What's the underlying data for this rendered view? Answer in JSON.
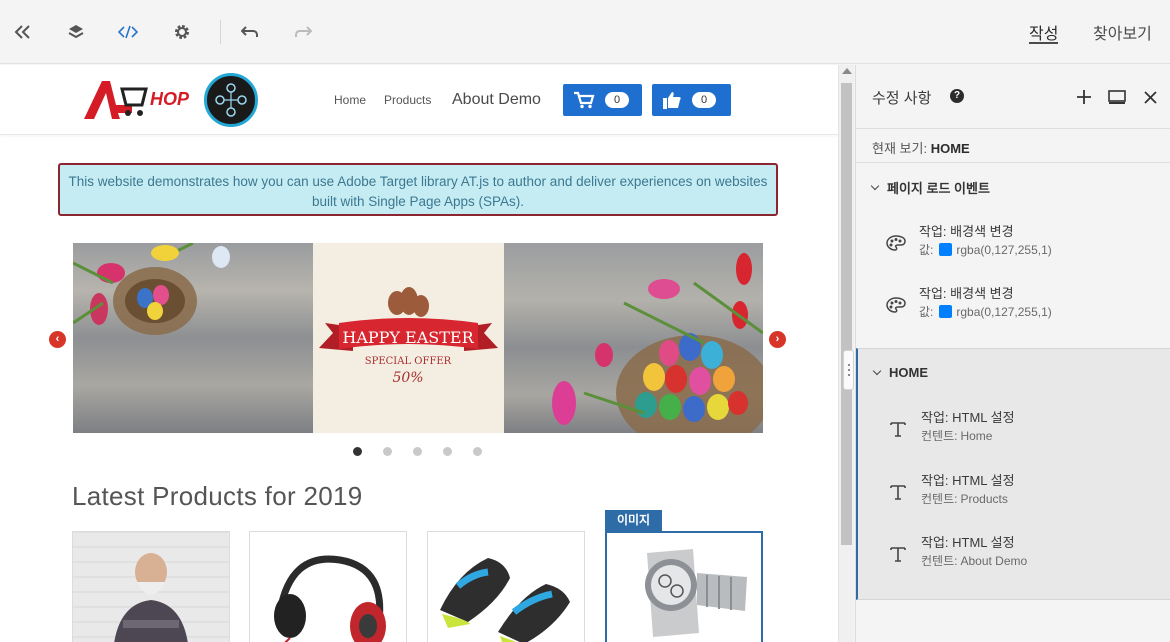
{
  "toolbar": {
    "mode_tabs": [
      "작성",
      "찾아보기"
    ]
  },
  "site": {
    "logo_text": "ASHOP",
    "nav": [
      "Home",
      "Products",
      "About Demo"
    ],
    "cart_count": "0",
    "like_count": "0",
    "notice": "This website demonstrates how you can use Adobe Target library AT.js to author and deliver experiences on websites built with Single Page Apps (SPAs).",
    "banner": {
      "title": "HAPPY EASTER",
      "subtitle": "SPECIAL OFFER",
      "discount": "50%"
    },
    "carousel_dots": 5,
    "carousel_active": 0,
    "heading": "Latest Products for 2019",
    "selected_label": "이미지"
  },
  "panel": {
    "title": "수정 사항",
    "view_prefix": "현재 보기:",
    "view_name": "HOME",
    "sections": [
      {
        "title": "페이지 로드 이벤트",
        "actions": [
          {
            "title": "작업: 배경색 변경",
            "sub_label": "값:",
            "sub_value": "rgba(0,127,255,1)"
          },
          {
            "title": "작업: 배경색 변경",
            "sub_label": "값:",
            "sub_value": "rgba(0,127,255,1)"
          }
        ]
      },
      {
        "title": "HOME",
        "actions": [
          {
            "title": "작업: HTML 설정",
            "sub_label": "컨텐트:",
            "sub_value": "Home"
          },
          {
            "title": "작업: HTML 설정",
            "sub_label": "컨텐트:",
            "sub_value": "Products"
          },
          {
            "title": "작업: HTML 설정",
            "sub_label": "컨텐트:",
            "sub_value": "About Demo"
          }
        ]
      }
    ]
  },
  "colors": {
    "accent": "#2e6ca8",
    "site_button": "#1f6fd1",
    "swatch": "#007fff",
    "notice_bg": "#c5ecf2",
    "notice_border": "#8b2530"
  },
  "icons": [
    "collapse-icon",
    "layers-icon",
    "code-icon",
    "gear-icon",
    "undo-icon",
    "redo-icon",
    "help-icon",
    "plus-icon",
    "monitor-icon",
    "close-icon",
    "palette-icon",
    "text-icon",
    "cart-icon",
    "thumbs-up-icon"
  ]
}
